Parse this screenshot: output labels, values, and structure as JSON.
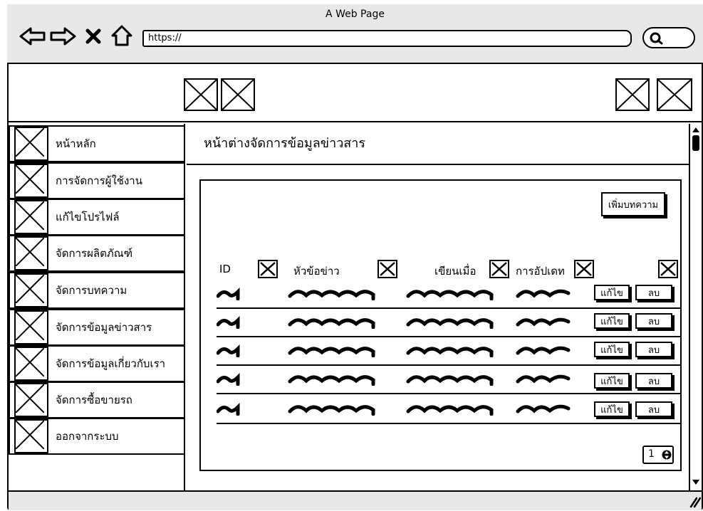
{
  "window": {
    "title": "A Web Page",
    "url": "https://"
  },
  "sidebar": {
    "items": [
      {
        "label": "หน้าหลัก"
      },
      {
        "label": "การจัดการผู้ใช้งาน"
      },
      {
        "label": "แก้ไขโปรไฟล์"
      },
      {
        "label": "จัดการผลิตภัณฑ์"
      },
      {
        "label": "จัดการบทความ"
      },
      {
        "label": "จัดการข้อมูลข่าวสาร"
      },
      {
        "label": "จัดการข้อมูลเกี่ยวกับเรา"
      },
      {
        "label": "จัดการซื้อขายรถ"
      },
      {
        "label": "ออกจากระบบ"
      }
    ]
  },
  "main": {
    "title": "หน้าต่างจัดการข้อมูลข่าวสาร",
    "add_button": "เพิ่มบทความ",
    "columns": [
      "ID",
      "หัวข้อข่าว",
      "เขียนเมื่อ",
      "การอัปเดท"
    ],
    "rows": [
      {
        "edit": "แก้ไข",
        "delete": "ลบ"
      },
      {
        "edit": "แก้ไข",
        "delete": "ลบ"
      },
      {
        "edit": "แก้ไข",
        "delete": "ลบ"
      },
      {
        "edit": "แก้ไข",
        "delete": "ลบ"
      },
      {
        "edit": "แก้ไข",
        "delete": "ลบ"
      }
    ],
    "pager_value": "1"
  }
}
